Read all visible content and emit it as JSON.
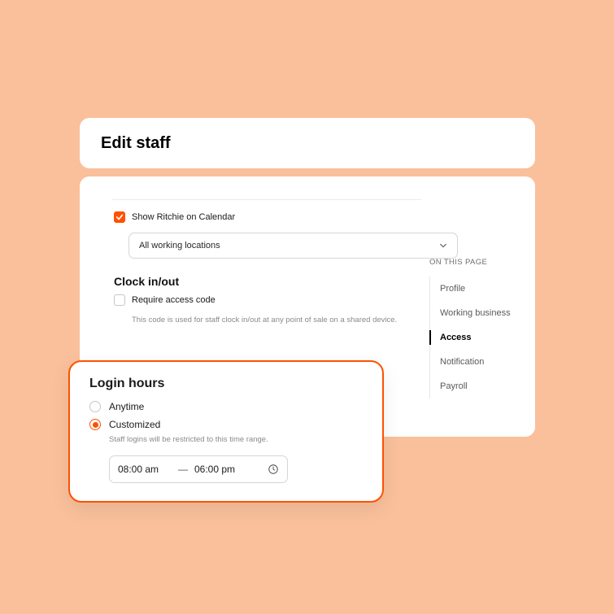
{
  "colors": {
    "accent": "#ff5100"
  },
  "header": {
    "title": "Edit staff"
  },
  "calendar": {
    "show_label": "Show Ritchie on Calendar",
    "select_label": "All working locations"
  },
  "clock": {
    "title": "Clock in/out",
    "require_label": "Require access code",
    "help": "This code is used for staff clock in/out at any point of sale on a shared device."
  },
  "onpage": {
    "title": "ON THIS PAGE",
    "items": [
      {
        "label": "Profile",
        "active": false
      },
      {
        "label": "Working business",
        "active": false
      },
      {
        "label": "Access",
        "active": true
      },
      {
        "label": "Notification",
        "active": false
      },
      {
        "label": "Payroll",
        "active": false
      }
    ]
  },
  "login_hours": {
    "title": "Login hours",
    "option_anytime": "Anytime",
    "option_customized": "Customized",
    "help": "Staff logins will be restricted to this time range.",
    "start": "08:00 am",
    "dash": "—",
    "end": "06:00 pm"
  }
}
